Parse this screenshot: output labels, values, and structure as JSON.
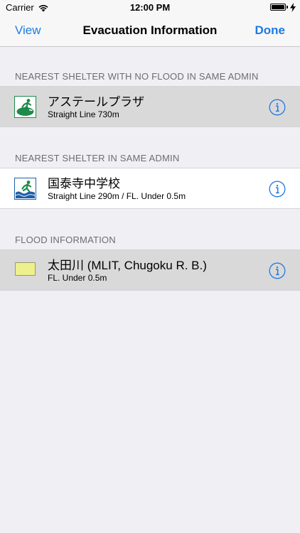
{
  "status_bar": {
    "carrier": "Carrier",
    "time": "12:00 PM",
    "battery_level_percent": 100
  },
  "nav": {
    "left_label": "View",
    "title": "Evacuation Information",
    "right_label": "Done"
  },
  "sections": [
    {
      "header": "NEAREST SHELTER WITH NO FLOOD IN SAME ADMIN",
      "item": {
        "title": "アステールプラザ",
        "subtitle": "Straight Line 730m",
        "icon": "evacuation-shelter-icon",
        "selected": true
      }
    },
    {
      "header": "NEAREST SHELTER IN SAME ADMIN",
      "item": {
        "title": "国泰寺中学校",
        "subtitle": "Straight Line 290m / FL. Under 0.5m",
        "icon": "flood-evacuation-shelter-icon",
        "selected": false
      }
    },
    {
      "header": "FLOOD INFORMATION",
      "item": {
        "title": "太田川 (MLIT, Chugoku R. B.)",
        "subtitle": "FL. Under 0.5m",
        "swatch_color": "#eef08e",
        "selected": true
      }
    }
  ],
  "colors": {
    "accent": "#1f7ae0",
    "background": "#efeff4",
    "selected_row": "#d9d9d9",
    "shelter_green": "#1d8a4c"
  }
}
